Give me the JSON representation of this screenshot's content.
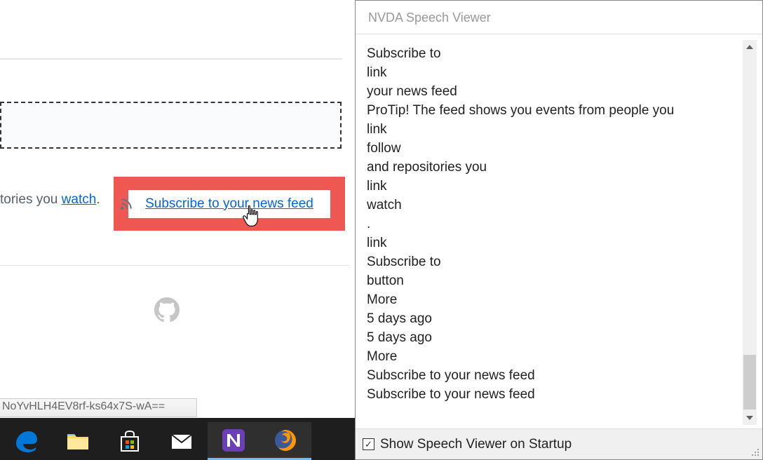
{
  "browser": {
    "text_fragment": "tories you ",
    "watch_link": "watch",
    "period": ".",
    "subscribe_link": "Subscribe to your news feed",
    "status_bar": "NoYvHLH4EV8rf-ks64x7S-wA=="
  },
  "nvda": {
    "title": "NVDA Speech Viewer",
    "lines": [
      "Subscribe to",
      "link",
      "your news feed",
      " ProTip! The feed shows you events from people you",
      "link",
      "follow",
      " and repositories you",
      "link",
      "watch",
      ".",
      "link",
      "Subscribe to",
      "button",
      "More",
      "5 days ago",
      "5 days ago",
      "More",
      " Subscribe to your news feed",
      " Subscribe to your news feed"
    ],
    "footer_label": "Show Speech Viewer on Startup"
  },
  "taskbar": {
    "items": [
      {
        "name": "edge"
      },
      {
        "name": "file-explorer"
      },
      {
        "name": "store"
      },
      {
        "name": "mail"
      },
      {
        "name": "nvda"
      },
      {
        "name": "firefox"
      }
    ]
  }
}
